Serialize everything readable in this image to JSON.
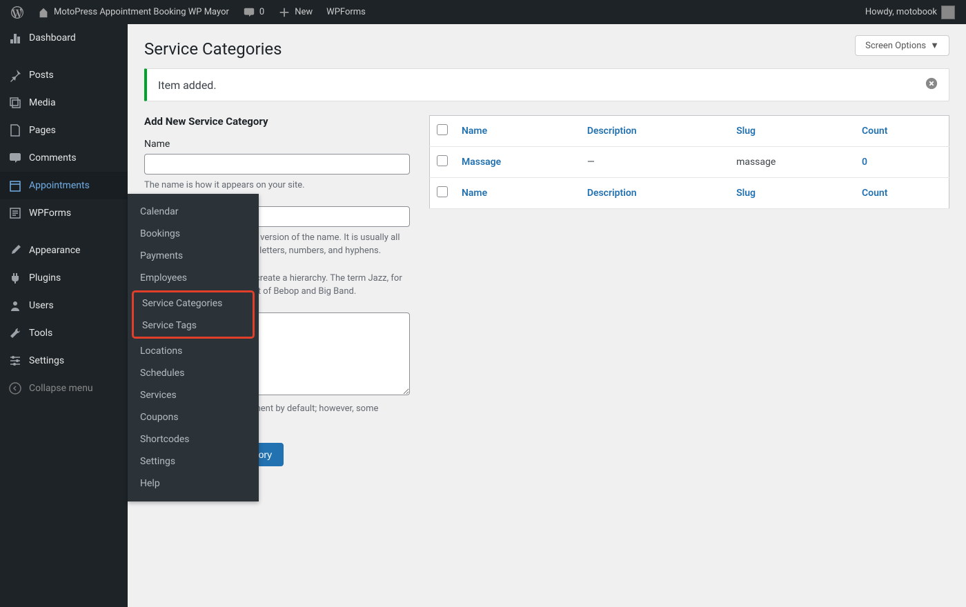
{
  "adminbar": {
    "site_name": "MotoPress Appointment Booking WP Mayor",
    "comments_count": "0",
    "new_label": "New",
    "wpforms_label": "WPForms",
    "howdy": "Howdy, motobook"
  },
  "sidebar": {
    "items": [
      {
        "label": "Dashboard"
      },
      {
        "label": "Posts"
      },
      {
        "label": "Media"
      },
      {
        "label": "Pages"
      },
      {
        "label": "Comments"
      },
      {
        "label": "Appointments"
      },
      {
        "label": "WPForms"
      },
      {
        "label": "Appearance"
      },
      {
        "label": "Plugins"
      },
      {
        "label": "Users"
      },
      {
        "label": "Tools"
      },
      {
        "label": "Settings"
      },
      {
        "label": "Collapse menu"
      }
    ]
  },
  "submenu": {
    "items": [
      {
        "label": "Calendar"
      },
      {
        "label": "Bookings"
      },
      {
        "label": "Payments"
      },
      {
        "label": "Employees"
      },
      {
        "label": "Service Categories"
      },
      {
        "label": "Service Tags"
      },
      {
        "label": "Locations"
      },
      {
        "label": "Schedules"
      },
      {
        "label": "Services"
      },
      {
        "label": "Coupons"
      },
      {
        "label": "Shortcodes"
      },
      {
        "label": "Settings"
      },
      {
        "label": "Help"
      }
    ]
  },
  "page": {
    "title": "Service Categories",
    "screen_options": "Screen Options",
    "notice": "Item added."
  },
  "form": {
    "title": "Add New Service Category",
    "name_label": "Name",
    "name_help": "The name is how it appears on your site.",
    "slug_help": "The \"slug\" is the URL-friendly version of the name. It is usually all lowercase and contains only letters, numbers, and hyphens.",
    "parent_help": "Categories, unlike tags, can create a hierarchy. The term Jazz, for example, would be the parent of Bebop and Big Band.",
    "desc_help": "The description is not prominent by default; however, some themes may show it.",
    "submit": "Add New Service Category"
  },
  "table": {
    "cols": {
      "name": "Name",
      "description": "Description",
      "slug": "Slug",
      "count": "Count"
    },
    "rows": [
      {
        "name": "Massage",
        "description": "—",
        "slug": "massage",
        "count": "0"
      }
    ]
  }
}
